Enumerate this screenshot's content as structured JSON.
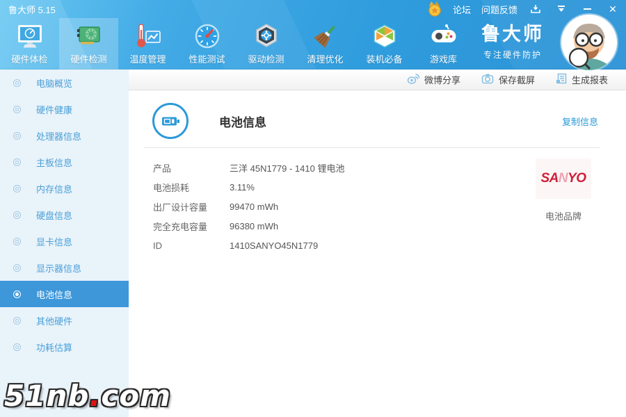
{
  "window": {
    "title": "鲁大师 5.15"
  },
  "titlebar": {
    "links": [
      {
        "label": "论坛"
      },
      {
        "label": "问题反馈"
      }
    ]
  },
  "toolbar": {
    "tabs": [
      {
        "label": "硬件体检",
        "active": false
      },
      {
        "label": "硬件检测",
        "active": true
      },
      {
        "label": "温度管理",
        "active": false
      },
      {
        "label": "性能测试",
        "active": false
      },
      {
        "label": "驱动检测",
        "active": false
      },
      {
        "label": "清理优化",
        "active": false
      },
      {
        "label": "装机必备",
        "active": false
      },
      {
        "label": "游戏库",
        "active": false
      }
    ],
    "brand": {
      "name": "鲁大师",
      "slogan": "专注硬件防护"
    }
  },
  "actionbar": {
    "buttons": [
      {
        "label": "微博分享"
      },
      {
        "label": "保存截屏"
      },
      {
        "label": "生成报表"
      }
    ]
  },
  "sidebar": {
    "items": [
      {
        "label": "电脑概览",
        "active": false
      },
      {
        "label": "硬件健康",
        "active": false
      },
      {
        "label": "处理器信息",
        "active": false
      },
      {
        "label": "主板信息",
        "active": false
      },
      {
        "label": "内存信息",
        "active": false
      },
      {
        "label": "硬盘信息",
        "active": false
      },
      {
        "label": "显卡信息",
        "active": false
      },
      {
        "label": "显示器信息",
        "active": false
      },
      {
        "label": "电池信息",
        "active": true
      },
      {
        "label": "其他硬件",
        "active": false
      },
      {
        "label": "功耗估算",
        "active": false
      }
    ]
  },
  "main": {
    "title": "电池信息",
    "copy_link": "复制信息",
    "rows": [
      {
        "label": "产品",
        "value": "三洋 45N1779 - 1410 锂电池"
      },
      {
        "label": "电池损耗",
        "value": "3.11%"
      },
      {
        "label": "出厂设计容量",
        "value": "99470 mWh"
      },
      {
        "label": "完全充电容量",
        "value": "96380 mWh"
      },
      {
        "label": "ID",
        "value": "1410SANYO45N1779"
      }
    ],
    "brand_panel": {
      "logo_p1": "SA",
      "logo_p2": "N",
      "logo_p3": "YO",
      "caption": "电池品牌"
    }
  },
  "watermark": {
    "p1": "51nb",
    "dot": ".",
    "p2": "com"
  },
  "colors": {
    "topbar_blue": "#2e9bdf",
    "sidebar_bg": "#e9f3fa",
    "sidebar_active": "#3d97d9",
    "link_blue": "#2a9ad8",
    "sanyo_red": "#cf2038"
  }
}
